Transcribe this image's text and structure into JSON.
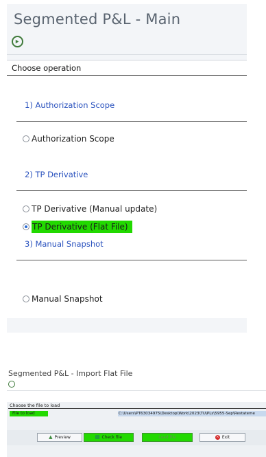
{
  "top_window": {
    "title": "Segmented P&L - Main",
    "choose_label": "Choose operation",
    "sections": [
      {
        "title": "1) Authorization Scope",
        "options": [
          {
            "label": "Authorization Scope",
            "selected": false
          }
        ]
      },
      {
        "title": "2) TP Derivative",
        "options": [
          {
            "label": "TP Derivative (Manual update)",
            "selected": false
          },
          {
            "label": "TP Derivative (Flat File)",
            "selected": true,
            "highlight": "#22d900"
          }
        ]
      },
      {
        "title": "3) Manual Snapshot",
        "options": [
          {
            "label": "Manual Snapshot",
            "selected": false
          }
        ]
      }
    ],
    "toolbar_icon": "execute-icon"
  },
  "bottom_window": {
    "title": "Segmented P&L - Import Flat File",
    "toolbar_icon": "execute-icon",
    "choose_label": "Choose the file to load",
    "file_field_label": "File to load",
    "file_path": "C:\\Users\\PT63034975\\Desktop\\Work\\2023\\TU\\PLs\\5955-Sep\\Restateme",
    "buttons": {
      "preview": {
        "label": "Preview",
        "icon": "preview-icon"
      },
      "check": {
        "label": "Check file",
        "icon": "check-icon",
        "highlight": "#22d900"
      },
      "load": {
        "label": "Load file",
        "icon": "",
        "highlight": "#22d900"
      },
      "exit": {
        "label": "Exit",
        "icon": "exit-icon"
      }
    }
  },
  "colors": {
    "highlight_green": "#22d900",
    "section_blue": "#2a52be",
    "radio_blue": "#2a6ad4"
  }
}
